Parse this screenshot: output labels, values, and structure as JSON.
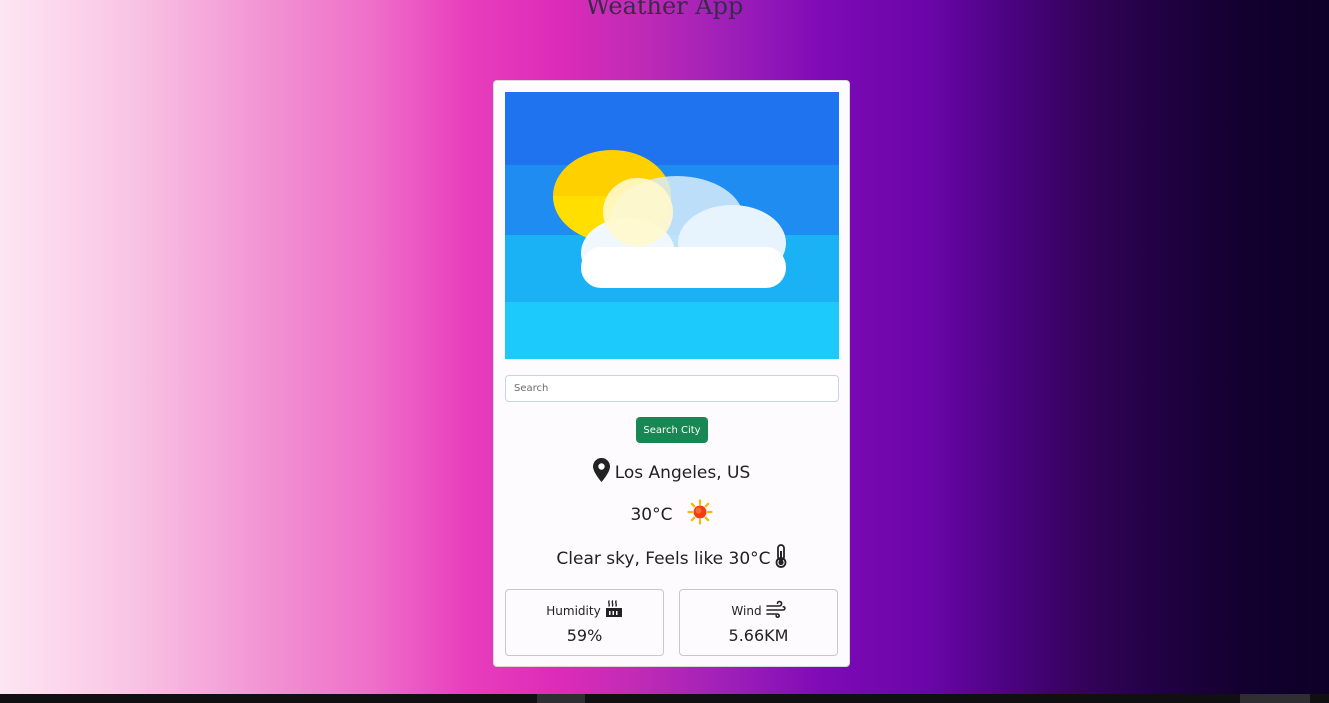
{
  "app": {
    "title": "Weather App"
  },
  "search": {
    "placeholder": "Search",
    "value": "",
    "button_label": "Search City"
  },
  "weather": {
    "location": "Los Angeles, US",
    "temperature": "30°C",
    "description": "Clear sky, Feels like 30°C",
    "condition_icon": "sun-icon"
  },
  "stats": {
    "humidity": {
      "label": "Humidity",
      "value": "59%",
      "icon": "humidity-icon"
    },
    "wind": {
      "label": "Wind",
      "value": "5.66KM",
      "icon": "wind-icon"
    }
  },
  "colors": {
    "card_background": "#fdfbfe",
    "search_button": "#198754",
    "sky_top": "#1f73ee",
    "sky_bottom": "#1ccafc",
    "sun": "#ffd000"
  }
}
